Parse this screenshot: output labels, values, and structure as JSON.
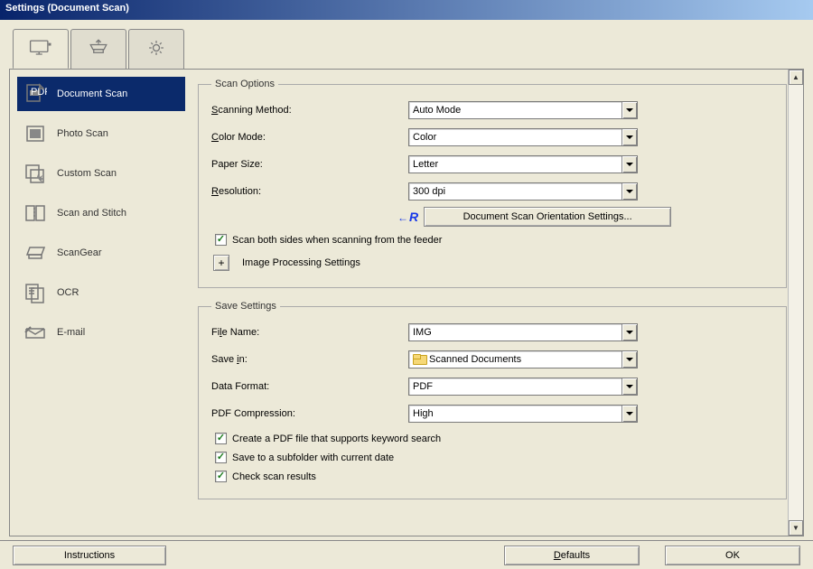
{
  "window": {
    "title": "Settings (Document Scan)"
  },
  "sidebar": {
    "items": [
      {
        "label": "Document Scan"
      },
      {
        "label": "Photo Scan"
      },
      {
        "label": "Custom Scan"
      },
      {
        "label": "Scan and Stitch"
      },
      {
        "label": "ScanGear"
      },
      {
        "label": "OCR"
      },
      {
        "label": "E-mail"
      }
    ]
  },
  "scan_options": {
    "legend": "Scan Options",
    "scanning_method_label_pre": "S",
    "scanning_method_label_post": "canning Method:",
    "scanning_method_value": "Auto Mode",
    "color_mode_label_pre": "C",
    "color_mode_label_post": "olor Mode:",
    "color_mode_value": "Color",
    "paper_size_label": "Paper Size:",
    "paper_size_value": "Letter",
    "resolution_label_pre": "R",
    "resolution_label_post": "esolution:",
    "resolution_value": "300 dpi",
    "orientation_btn": "Document Scan Orientation Settings...",
    "scan_both_sides": "Scan both sides when scanning from the feeder",
    "image_processing": "Image Processing Settings"
  },
  "save_settings": {
    "legend": "Save Settings",
    "file_name_label_pre": "Fi",
    "file_name_label_ul": "l",
    "file_name_label_post": "e Name:",
    "file_name_value": "IMG",
    "save_in_label_pre": "Save ",
    "save_in_label_ul": "i",
    "save_in_label_post": "n:",
    "save_in_value": "Scanned Documents",
    "data_format_label": "Data Format:",
    "data_format_value": "PDF",
    "pdf_compression_label": "PDF Compression:",
    "pdf_compression_value": "High",
    "create_pdf_keyword": "Create a PDF file that supports keyword search",
    "save_subfolder_pre": "Save to a subfolder ",
    "save_subfolder_ul": "w",
    "save_subfolder_post": "ith current date",
    "check_results": "Check scan results"
  },
  "bottom": {
    "instructions": "Instructions",
    "defaults_pre": "",
    "defaults_ul": "D",
    "defaults_post": "efaults",
    "ok": "OK"
  }
}
